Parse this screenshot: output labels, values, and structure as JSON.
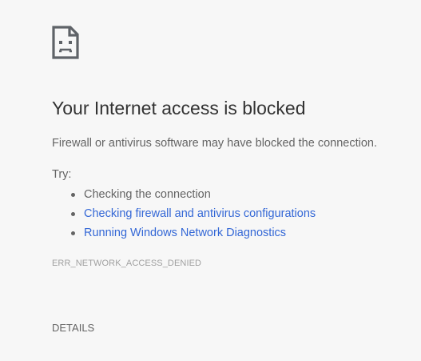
{
  "error_page": {
    "icon": "sad-page-icon",
    "heading": "Your Internet access is blocked",
    "message": "Firewall or antivirus software may have blocked the connection.",
    "try_label": "Try:",
    "suggestions": [
      {
        "text": "Checking the connection",
        "is_link": false
      },
      {
        "text": "Checking firewall and antivirus configurations",
        "is_link": true
      },
      {
        "text": "Running Windows Network Diagnostics",
        "is_link": true
      }
    ],
    "error_code": "ERR_NETWORK_ACCESS_DENIED",
    "details_label": "DETAILS"
  },
  "colors": {
    "background": "#f7f7f7",
    "heading": "#333333",
    "body_text": "#646464",
    "link": "#3367d6",
    "error_code": "#a0a0a0"
  }
}
